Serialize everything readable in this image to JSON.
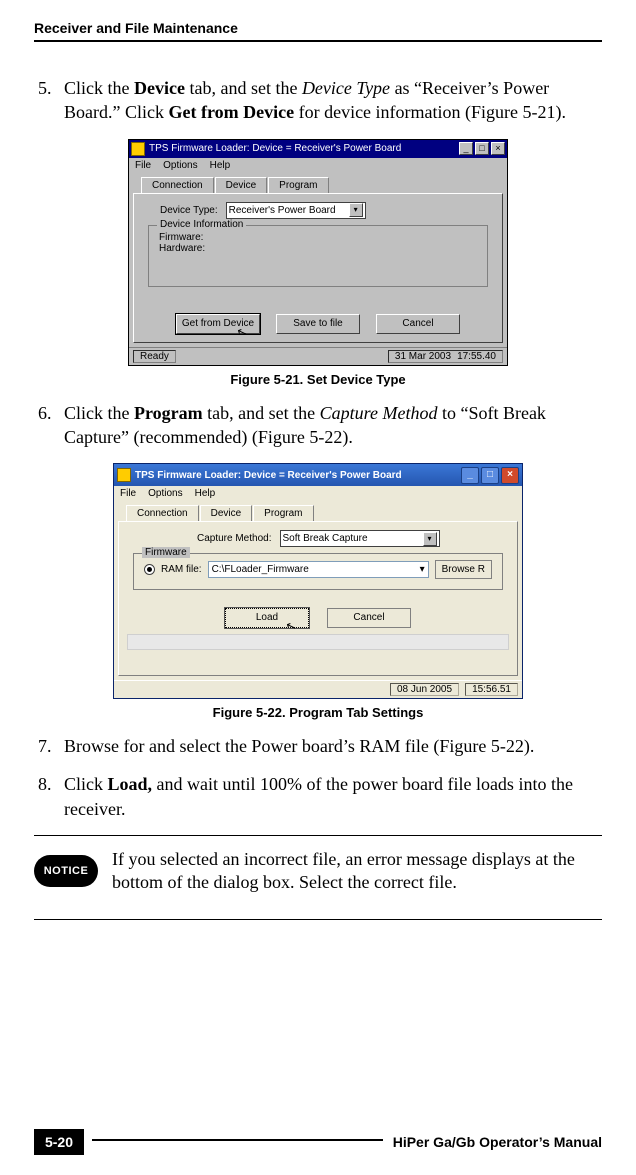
{
  "header": "Receiver and File Maintenance",
  "steps": {
    "s5": {
      "num": "5.",
      "t1": "Click the ",
      "b1": "Device",
      "t2": " tab, and set the ",
      "i1": "Device Type",
      "t3": " as “Receiver’s Power Board.” Click ",
      "b2": "Get from Device",
      "t4": " for device information (Figure 5-21)."
    },
    "s6": {
      "num": "6.",
      "t1": "Click the ",
      "b1": "Program",
      "t2": " tab, and set the ",
      "i1": "Capture Method",
      "t3": " to “Soft Break Capture” (recommended) (Figure 5-22)."
    },
    "s7": {
      "num": "7.",
      "t1": "Browse for and select the Power board’s RAM file (Figure 5-22)."
    },
    "s8": {
      "num": "8.",
      "t1": "Click ",
      "b1": "Load,",
      "t2": " and wait until 100% of the power board file loads into the receiver."
    }
  },
  "fig1": {
    "title": "TPS Firmware Loader:  Device = Receiver's Power Board",
    "menu": {
      "file": "File",
      "options": "Options",
      "help": "Help"
    },
    "tabs": {
      "connection": "Connection",
      "device": "Device",
      "program": "Program"
    },
    "device_type_label": "Device Type:",
    "device_type_value": "Receiver's Power Board",
    "group_label": "Device Information",
    "firmware_label": "Firmware:",
    "hardware_label": "Hardware:",
    "btn_get": "Get from Device",
    "btn_save": "Save to file",
    "btn_cancel": "Cancel",
    "status_ready": "Ready",
    "status_date": "31 Mar 2003",
    "status_time": "17:55.40",
    "caption": "Figure 5-21. Set Device Type"
  },
  "fig2": {
    "title": "TPS Firmware Loader:  Device = Receiver's Power Board",
    "menu": {
      "file": "File",
      "options": "Options",
      "help": "Help"
    },
    "tabs": {
      "connection": "Connection",
      "device": "Device",
      "program": "Program"
    },
    "capture_label": "Capture Method:",
    "capture_value": "Soft Break Capture",
    "group_label": "Firmware",
    "ram_label": "RAM file:",
    "ram_value": "C:\\FLoader_Firmware",
    "btn_browse": "Browse R",
    "btn_load": "Load",
    "btn_cancel": "Cancel",
    "status_date": "08 Jun 2005",
    "status_time": "15:56.51",
    "caption": "Figure 5-22. Program Tab Settings"
  },
  "notice": {
    "badge": "NOTICE",
    "text": "If you selected an incorrect file, an error message displays at the bottom of the dialog box. Select the correct file."
  },
  "footer": {
    "page": "5-20",
    "manual": "HiPer Ga/Gb Operator’s Manual"
  }
}
